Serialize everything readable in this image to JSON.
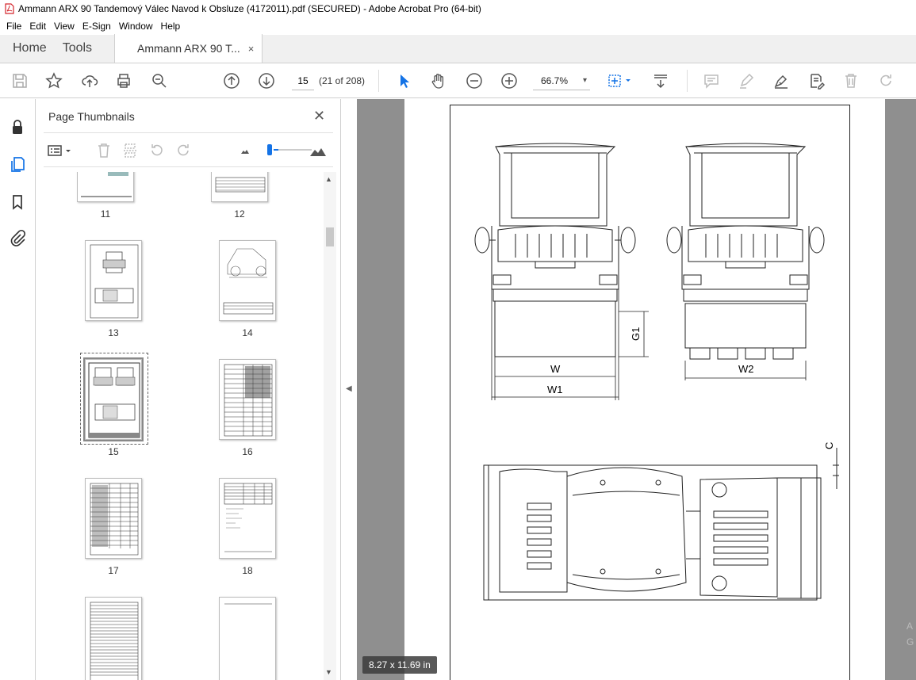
{
  "window": {
    "title": "Ammann ARX 90 Tandemový Válec Navod k Obsluze (4172011).pdf (SECURED) - Adobe Acrobat Pro (64-bit)"
  },
  "menu": [
    "File",
    "Edit",
    "View",
    "E-Sign",
    "Window",
    "Help"
  ],
  "tabs": {
    "home": "Home",
    "tools": "Tools",
    "document": "Ammann ARX 90 T...",
    "close": "×"
  },
  "toolbar": {
    "page_number": "15",
    "page_count": "(21 of 208)",
    "zoom": "66.7%",
    "zoom_caret": "▾",
    "accent": "#1473e6"
  },
  "panel": {
    "title": "Page Thumbnails",
    "close": "✕",
    "thumbnails": [
      {
        "label": "11"
      },
      {
        "label": "12"
      },
      {
        "label": "13"
      },
      {
        "label": "14"
      },
      {
        "label": "15",
        "selected": true
      },
      {
        "label": "16"
      },
      {
        "label": "17"
      },
      {
        "label": "18"
      },
      {
        "label": ""
      },
      {
        "label": ""
      }
    ]
  },
  "viewer": {
    "page_size": "8.27 x 11.69 in",
    "drawing_labels": {
      "w": "W",
      "w1": "W1",
      "w2": "W2",
      "g1": "G1",
      "c": "C"
    },
    "edge_text": [
      "A",
      "G"
    ]
  }
}
